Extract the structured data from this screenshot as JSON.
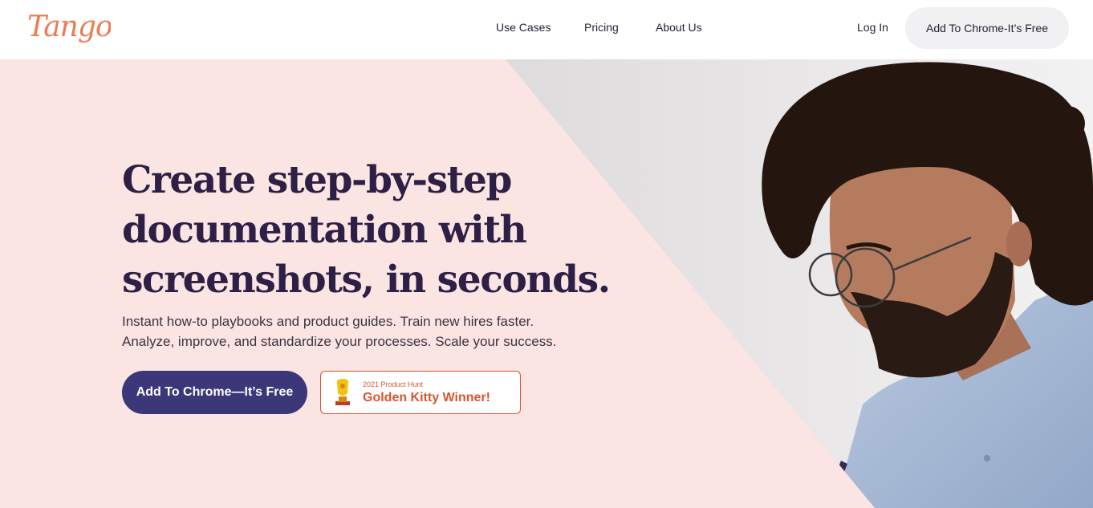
{
  "brand": {
    "logo_text": "Tango",
    "accent_color": "#ee7a52"
  },
  "nav": {
    "items": [
      "Use Cases",
      "Pricing",
      "About Us"
    ],
    "login": "Log In",
    "cta": "Add To Chrome-It’s Free"
  },
  "hero": {
    "title_lines": [
      "Create step-by-step",
      "documentation with",
      "screenshots, in seconds."
    ],
    "subtitle_lines": [
      "Instant how-to playbooks and product guides. Train new hires faster.",
      "Analyze, improve, and standardize your processes. Scale your success."
    ],
    "cta": "Add To Chrome—It’s Free",
    "cta_color": "#3c3779",
    "background_color": "#fbe5e3"
  },
  "award": {
    "small": "2021 Product Hunt",
    "big": "Golden Kitty Winner!",
    "icon": "trophy-icon",
    "color": "#d9552f"
  }
}
